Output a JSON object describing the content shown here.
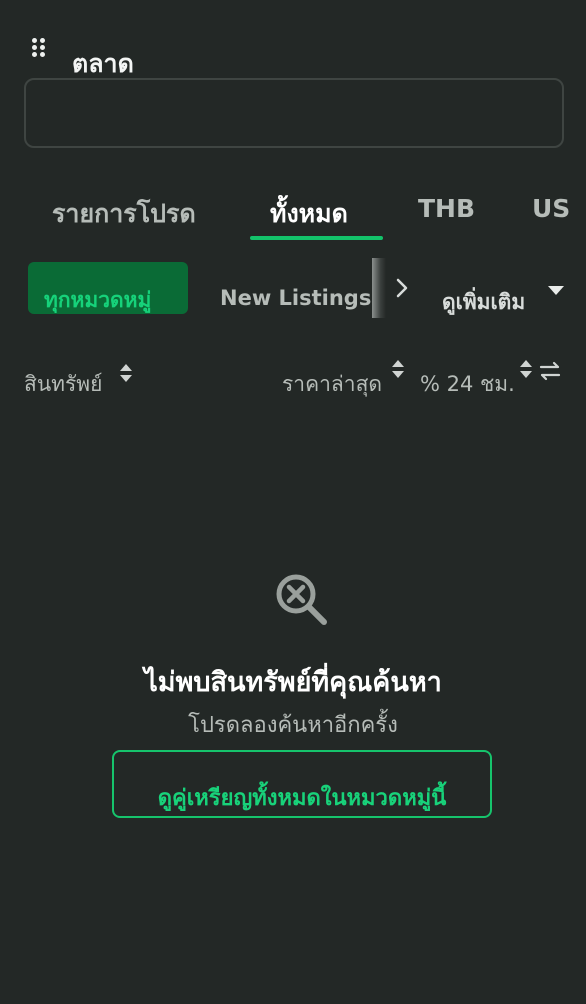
{
  "header": {
    "title": "ตลาด",
    "menu_icon": "grip-dots-icon",
    "search": {
      "value": "",
      "placeholder": ""
    }
  },
  "tabs": [
    {
      "label": "รายการโปรด",
      "active": false
    },
    {
      "label": "ทั้งหมด",
      "active": true
    },
    {
      "label": "THB",
      "active": false
    },
    {
      "label": "US",
      "active": false
    }
  ],
  "categories": {
    "active": "ทุกหมวดหมู่",
    "items": [
      "New Listings"
    ],
    "more": "ดูเพิ่มเติม"
  },
  "columns": {
    "asset": "สินทรัพย์",
    "price": "ราคาล่าสุด",
    "change": "% 24 ชม."
  },
  "empty_state": {
    "icon": "search-x-icon",
    "title": "ไม่พบสินทรัพย์ที่คุณค้นหา",
    "subtitle": "โปรดลองค้นหาอีกครั้ง",
    "cta": "ดูคู่เหรียญทั้งหมดในหมวดหมู่นี้"
  },
  "colors": {
    "background": "#232826",
    "accent": "#13c36a",
    "chip_active_bg": "#0a6b36",
    "text_muted": "#b6bcb8"
  }
}
